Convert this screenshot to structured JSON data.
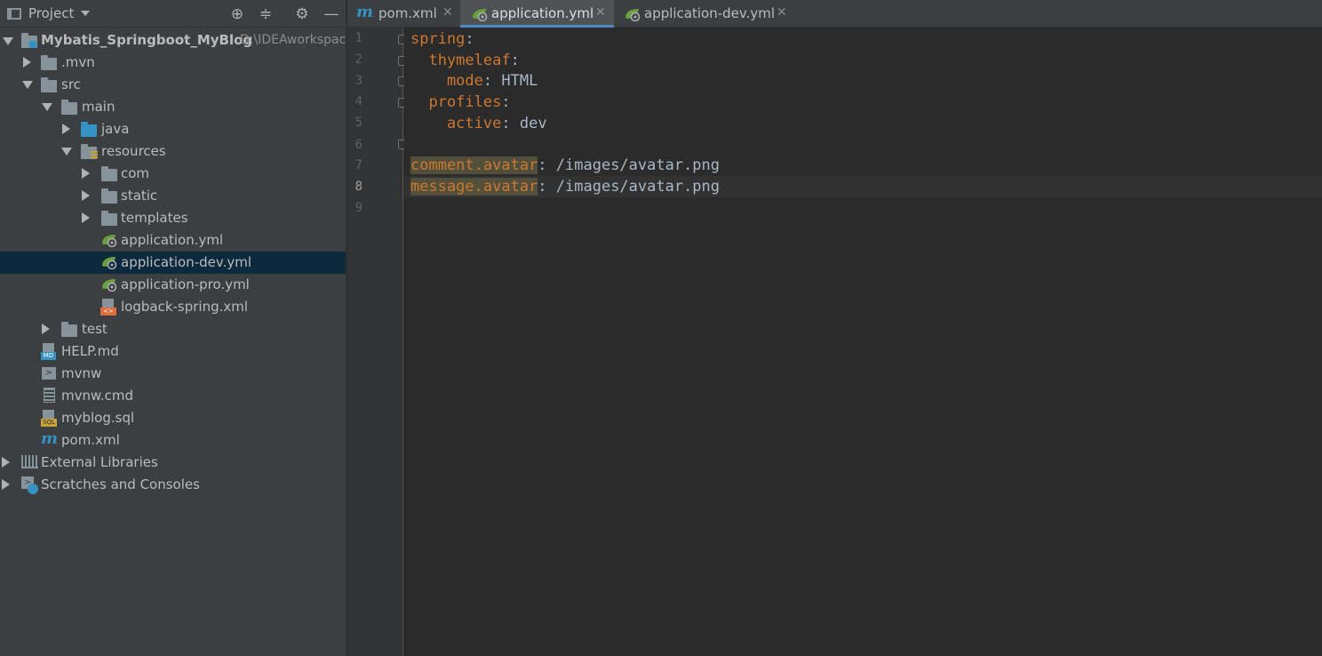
{
  "project_panel": {
    "title": "Project",
    "tree": [
      {
        "label": "Mybatis_Springboot_MyBlog",
        "hint": "D:\\IDEAworkspac",
        "icon": "module-folder-icon"
      },
      {
        "label": ".mvn",
        "icon": "folder-icon"
      },
      {
        "label": "src",
        "icon": "folder-icon"
      },
      {
        "label": "main",
        "icon": "folder-icon"
      },
      {
        "label": "java",
        "icon": "source-folder-icon"
      },
      {
        "label": "resources",
        "icon": "resources-folder-icon"
      },
      {
        "label": "com",
        "icon": "folder-icon"
      },
      {
        "label": "static",
        "icon": "folder-icon"
      },
      {
        "label": "templates",
        "icon": "folder-icon"
      },
      {
        "label": "application.yml",
        "icon": "spring-yaml-icon"
      },
      {
        "label": "application-dev.yml",
        "icon": "spring-yaml-icon"
      },
      {
        "label": "application-pro.yml",
        "icon": "spring-yaml-icon"
      },
      {
        "label": "logback-spring.xml",
        "icon": "xml-file-icon"
      },
      {
        "label": "test",
        "icon": "folder-icon"
      },
      {
        "label": "HELP.md",
        "icon": "markdown-file-icon"
      },
      {
        "label": "mvnw",
        "icon": "script-file-icon"
      },
      {
        "label": "mvnw.cmd",
        "icon": "text-file-icon"
      },
      {
        "label": "myblog.sql",
        "icon": "sql-file-icon"
      },
      {
        "label": "pom.xml",
        "icon": "maven-icon"
      },
      {
        "label": "External Libraries",
        "icon": "libraries-icon"
      },
      {
        "label": "Scratches and Consoles",
        "icon": "scratches-icon"
      }
    ],
    "selected": "application-dev.yml"
  },
  "tabs": [
    {
      "label": "pom.xml",
      "icon": "maven-icon",
      "active": false
    },
    {
      "label": "application.yml",
      "icon": "spring-yaml-icon",
      "active": true
    },
    {
      "label": "application-dev.yml",
      "icon": "spring-yaml-icon",
      "active": false
    }
  ],
  "editor": {
    "line_numbers": [
      "1",
      "2",
      "3",
      "4",
      "5",
      "6",
      "7",
      "8",
      "9"
    ],
    "current_line": 8,
    "lines": [
      {
        "key": "spring",
        "sep": ":",
        "value": ""
      },
      {
        "key": "  thymeleaf",
        "sep": ":",
        "value": ""
      },
      {
        "key": "    mode",
        "sep": ": ",
        "value": "HTML"
      },
      {
        "key": "  profiles",
        "sep": ":",
        "value": ""
      },
      {
        "key": "    active",
        "sep": ": ",
        "value": "dev"
      },
      {
        "key": "",
        "sep": "",
        "value": ""
      },
      {
        "key": "comment.avatar",
        "sep": ": ",
        "value": "/images/avatar.png"
      },
      {
        "key": "message.avatar",
        "sep": ": ",
        "value": "/images/avatar.png"
      },
      {
        "key": "",
        "sep": "",
        "value": ""
      }
    ]
  },
  "colors": {
    "key": "#cc7832",
    "value": "#a9b7c6",
    "selection": "#0d293e",
    "tab_underline": "#4a88c7"
  }
}
